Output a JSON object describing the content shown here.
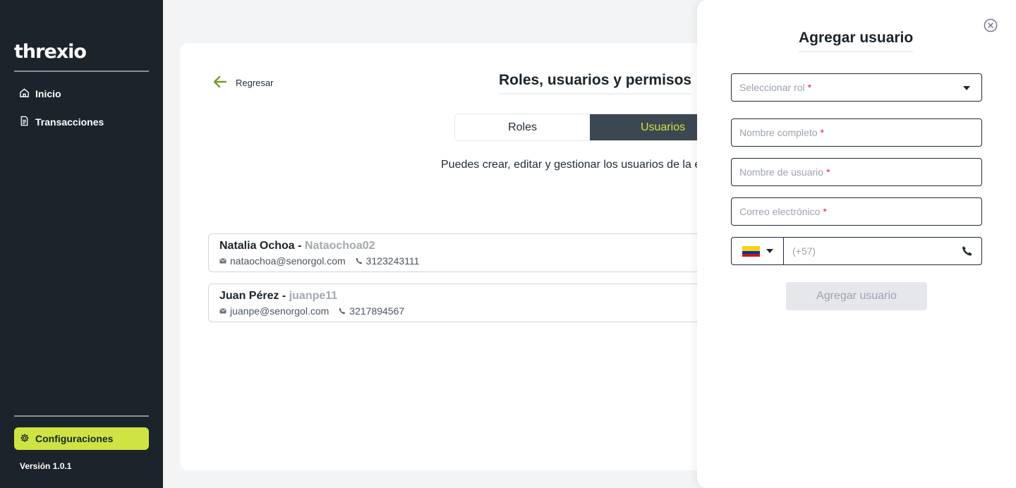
{
  "app": {
    "logo": "threxio",
    "version": "Versión 1.0.1"
  },
  "sidebar": {
    "items": [
      {
        "label": "Inicio",
        "icon": "home-icon"
      },
      {
        "label": "Transacciones",
        "icon": "document-icon"
      }
    ],
    "config_label": "Configuraciones",
    "config_icon": "gear-icon"
  },
  "colors": {
    "accent": "#cde443",
    "sidebar_bg": "#1b242b",
    "tab_active_bg": "#3b4852",
    "required": "#e11d48"
  },
  "main": {
    "back_label": "Regresar",
    "title": "Roles, usuarios y permisos",
    "tabs": [
      {
        "label": "Roles",
        "active": false
      },
      {
        "label": "Usuarios",
        "active": true
      }
    ],
    "description": "Puedes crear, editar y gestionar los usuarios de la e",
    "users": [
      {
        "name": "Natalia Ochoa - ",
        "handle": "Nataochoa02",
        "email": "nataochoa@senorgol.com",
        "phone": "3123243111"
      },
      {
        "name": "Juan Pérez - ",
        "handle": "juanpe11",
        "email": "juanpe@senorgol.com",
        "phone": "3217894567"
      }
    ]
  },
  "drawer": {
    "title": "Agregar usuario",
    "role_placeholder": "Seleccionar rol",
    "name_placeholder": "Nombre completo",
    "username_placeholder": "Nombre de usuario",
    "email_placeholder": "Correo electrónico",
    "required_mark": "*",
    "phone_prefix": "(+57)",
    "submit_label": "Agregar usuario"
  }
}
